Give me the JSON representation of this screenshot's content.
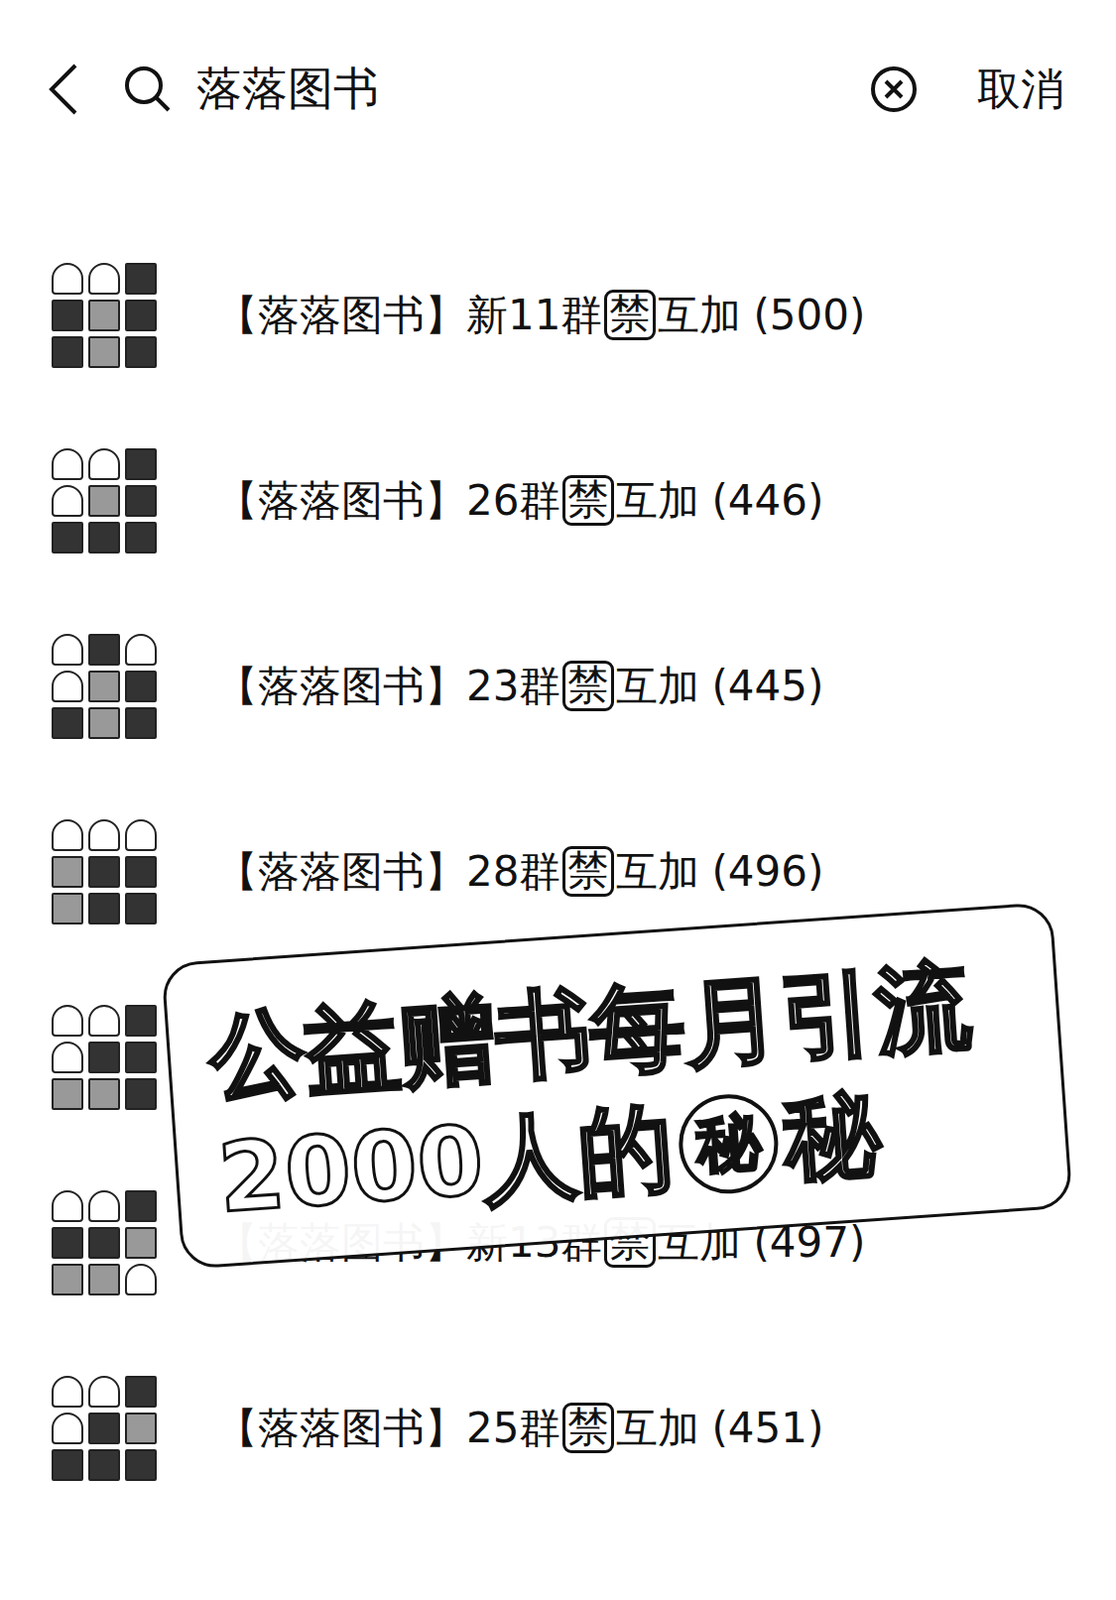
{
  "search": {
    "query": "落落图书",
    "cancel": "取消"
  },
  "results": [
    {
      "prefix": "【落落图书】新11群",
      "badge": "禁",
      "suffix": "互加",
      "count": "(500)"
    },
    {
      "prefix": "【落落图书】26群",
      "badge": "禁",
      "suffix": "互加",
      "count": "(446)"
    },
    {
      "prefix": "【落落图书】23群",
      "badge": "禁",
      "suffix": "互加",
      "count": "(445)"
    },
    {
      "prefix": "【落落图书】28群",
      "badge": "禁",
      "suffix": "互加",
      "count": "(496)"
    },
    {
      "prefix": "",
      "badge": "",
      "suffix": "",
      "count": ""
    },
    {
      "prefix": "【落落图书】新13群",
      "badge": "禁",
      "suffix": "互加",
      "count": "(497)"
    },
    {
      "prefix": "【落落图书】25群",
      "badge": "禁",
      "suffix": "互加",
      "count": "(451)"
    }
  ],
  "overlay": {
    "line1": "公益赠书每月引流",
    "line2": "2000人的",
    "circled": "秘",
    "end": "秘"
  }
}
